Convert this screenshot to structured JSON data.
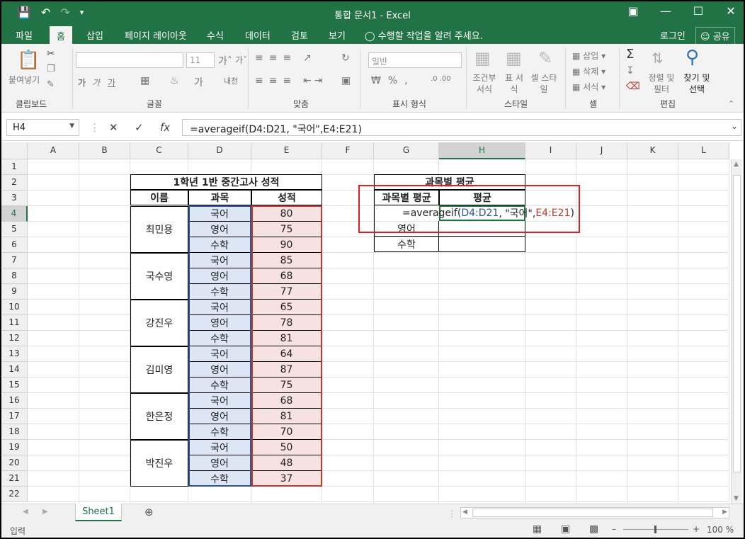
{
  "window": {
    "title": "통합 문서1 - Excel"
  },
  "tabs": [
    "파일",
    "홈",
    "삽입",
    "페이지 레이아웃",
    "수식",
    "데이터",
    "검토",
    "보기"
  ],
  "active_tab": "홈",
  "tell_me": "수행할 작업을 알려 주세요.",
  "login": "로그인",
  "share": "공유",
  "ribbon": {
    "clipboard": {
      "paste": "붙여넣기",
      "label": "클립보드"
    },
    "font": {
      "size": "11",
      "label": "글꼴",
      "bold": "가",
      "italic": "가",
      "underline": "가"
    },
    "alignment": {
      "label": "맞춤"
    },
    "number": {
      "format": "일반",
      "label": "표시 형식"
    },
    "styles": {
      "cond": "조건부 서식",
      "table": "표 서식",
      "cell": "셀 스타일",
      "label": "스타일"
    },
    "cells": {
      "insert": "삽입",
      "delete": "삭제",
      "format": "서식",
      "label": "셀"
    },
    "editing": {
      "sort": "정렬 및 필터",
      "find": "찾기 및 선택",
      "label": "편집"
    }
  },
  "formula_bar": {
    "name_box": "H4",
    "formula": "=averageif(D4:D21, \"국어\",E4:E21)"
  },
  "columns": [
    "A",
    "B",
    "C",
    "D",
    "E",
    "F",
    "G",
    "H",
    "I",
    "J",
    "K",
    "L"
  ],
  "rows": [
    "1",
    "2",
    "3",
    "4",
    "5",
    "6",
    "7",
    "8",
    "9",
    "10",
    "11",
    "12",
    "13",
    "14",
    "15",
    "16",
    "17",
    "18",
    "19",
    "20",
    "21",
    "22"
  ],
  "table": {
    "title": "1학년 1반 중간고사 성적",
    "headers": [
      "이름",
      "과목",
      "성적"
    ],
    "students": [
      "최민용",
      "국수영",
      "강진우",
      "김미영",
      "한은정",
      "박진우"
    ],
    "subjects": [
      "국어",
      "영어",
      "수학",
      "국어",
      "영어",
      "수학",
      "국어",
      "영어",
      "수학",
      "국어",
      "영어",
      "수학",
      "국어",
      "영어",
      "수학",
      "국어",
      "영어",
      "수학"
    ],
    "scores": [
      "80",
      "75",
      "90",
      "85",
      "68",
      "77",
      "65",
      "78",
      "81",
      "64",
      "87",
      "75",
      "68",
      "81",
      "70",
      "50",
      "48",
      "37"
    ]
  },
  "avg_table": {
    "title": "과목별 평균",
    "headers": [
      "과목별 평균",
      "평균"
    ],
    "editing_formula": {
      "prefix": "=averageif(",
      "range1": "D4:D21",
      "mid": ", \"국어\",",
      "range2": "E4:E21",
      "suffix": ")"
    },
    "subjects": [
      "영어",
      "수학"
    ]
  },
  "sheet_tab": "Sheet1",
  "status": {
    "mode": "입력",
    "zoom": "100 %"
  },
  "colors": {
    "excel_green": "#217346",
    "ref_blue": "#2f5597",
    "ref_red": "#c0392b",
    "highlight_red": "#e02020"
  }
}
